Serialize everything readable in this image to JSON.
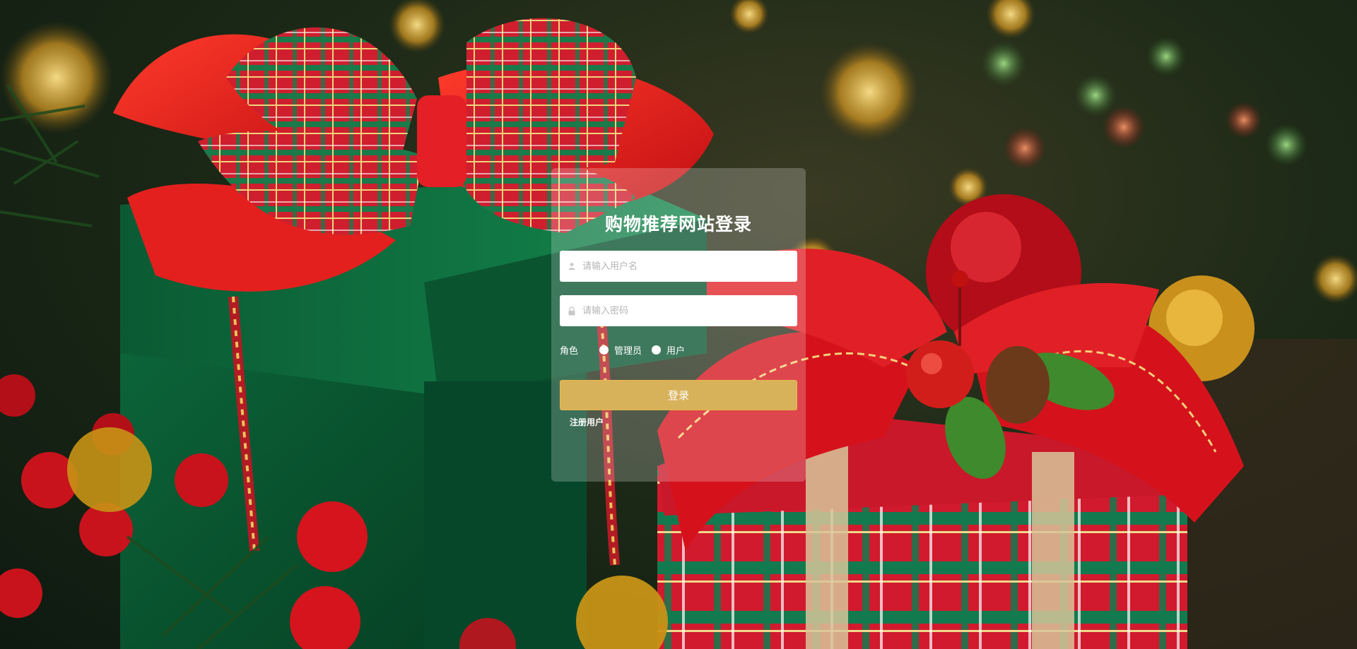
{
  "login": {
    "title": "购物推荐网站登录",
    "username_placeholder": "请输入用户名",
    "password_placeholder": "请输入密码",
    "role_label": "角色",
    "roles": [
      "管理员",
      "用户"
    ],
    "submit_label": "登录",
    "register_label": "注册用户"
  },
  "icons": {
    "username": "user-icon",
    "password": "lock-icon"
  },
  "colors": {
    "login_button": "#d8b15b",
    "panel": "rgba(255,255,255,0.22)"
  }
}
